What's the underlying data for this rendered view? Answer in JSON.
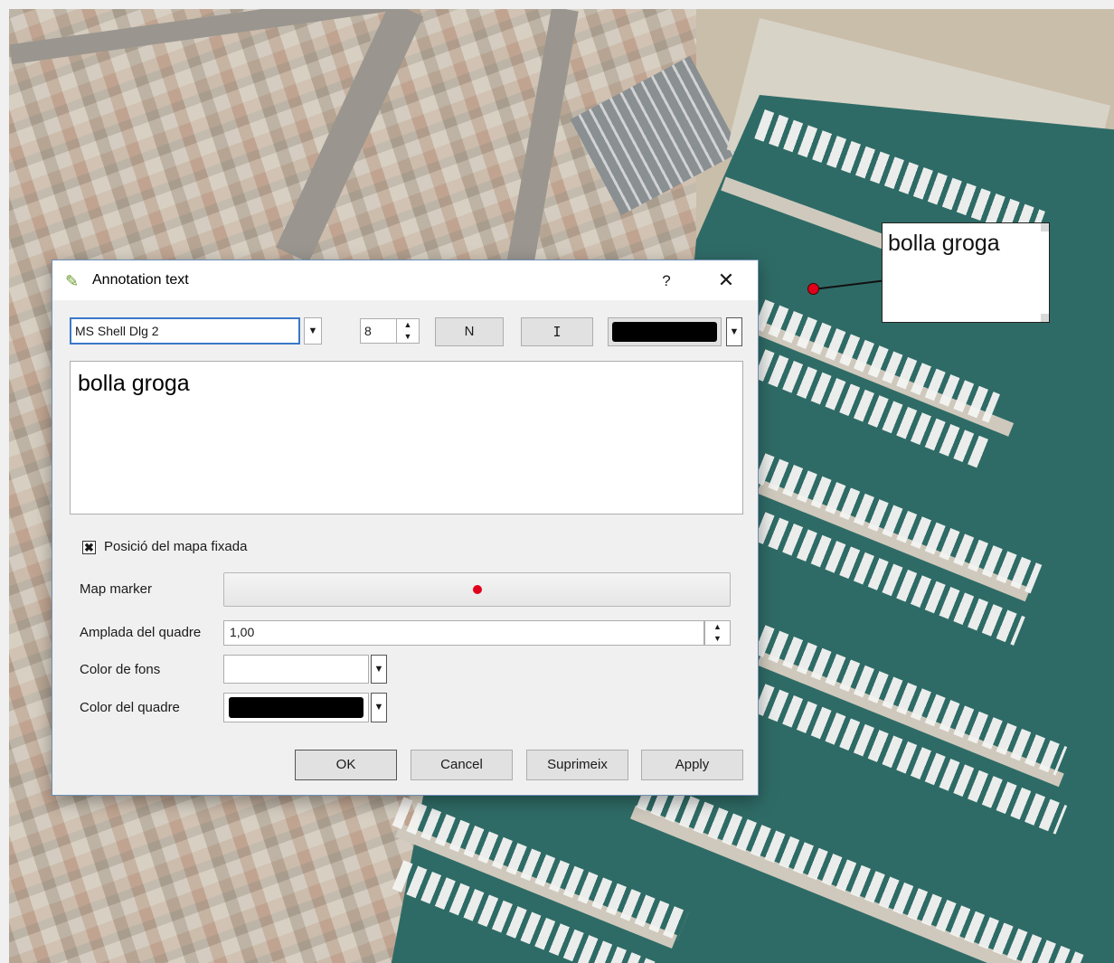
{
  "map": {
    "annotation_text": "bolla groga",
    "marker_color": "#e0001b"
  },
  "dialog": {
    "title": "Annotation text",
    "title_icon": "pencil-icon",
    "help_label": "?",
    "close_label": "✕",
    "toolbar": {
      "font_family": "MS Shell Dlg 2",
      "font_size": "8",
      "bold_label": "N",
      "italic_label": "I",
      "text_color": "#000000",
      "dropdown_arrow": "▼",
      "spin_arrows": "▲▼"
    },
    "text_content": "bolla groga",
    "fixed_position": {
      "checked": true,
      "mark": "✖",
      "label": "Posició del mapa fixada"
    },
    "fields": {
      "map_marker_label": "Map marker",
      "frame_width_label": "Amplada del quadre",
      "frame_width_value": "1,00",
      "background_color_label": "Color de fons",
      "background_color": "#ffffff",
      "frame_color_label": "Color del quadre",
      "frame_color": "#000000"
    },
    "buttons": {
      "ok": "OK",
      "cancel": "Cancel",
      "delete": "Suprimeix",
      "apply": "Apply"
    }
  }
}
